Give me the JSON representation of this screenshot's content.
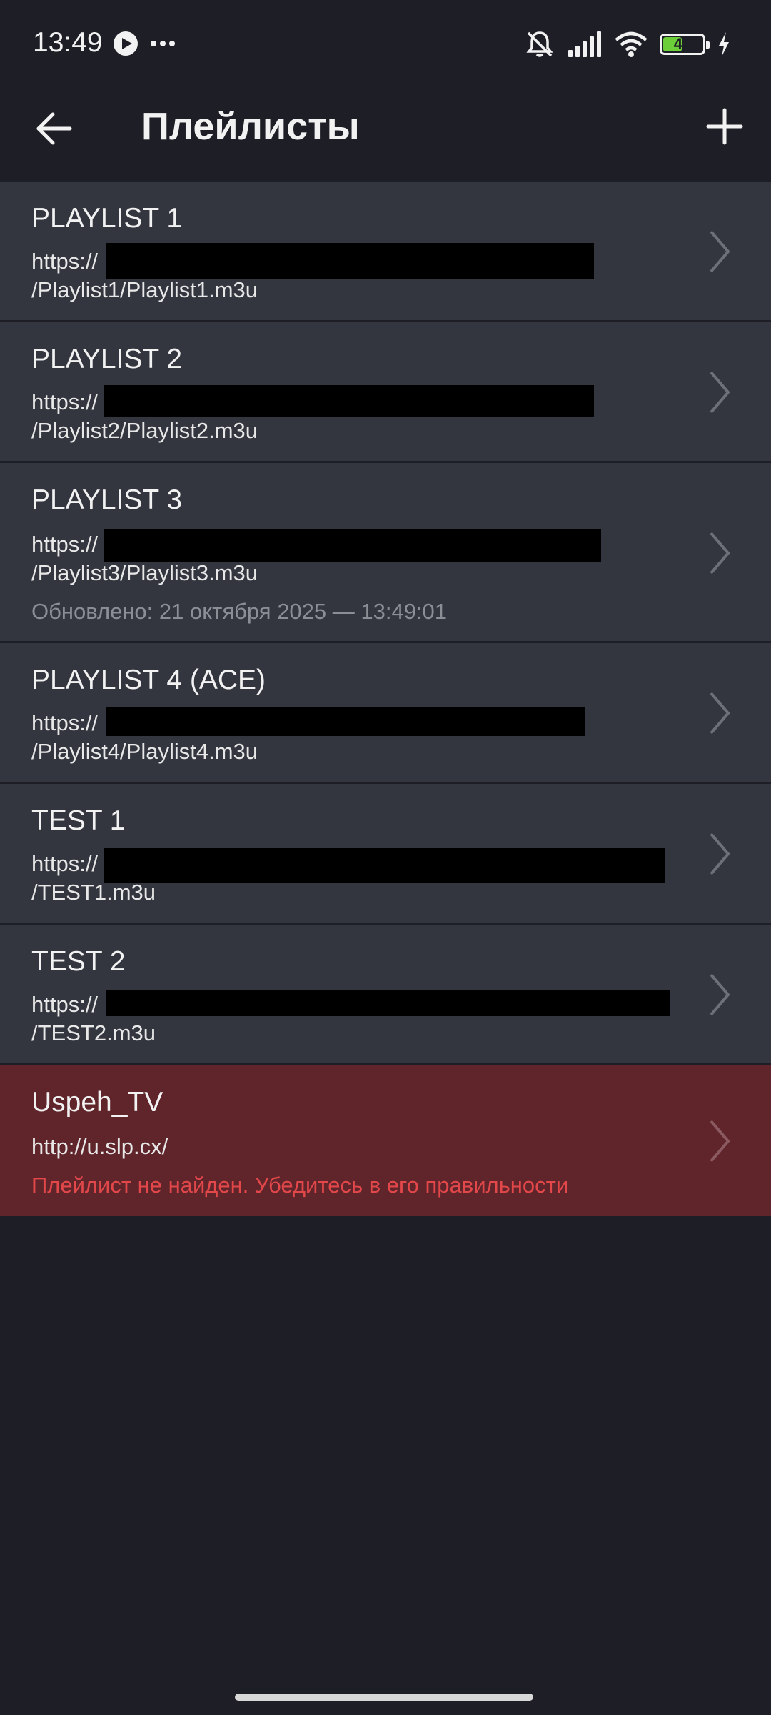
{
  "status_bar": {
    "time": "13:49",
    "battery_level": "47",
    "icons": [
      "play-badge-icon",
      "more-dots-icon",
      "mute-bell-icon",
      "signal-icon",
      "wifi-icon",
      "battery-icon",
      "charging-icon"
    ]
  },
  "app_bar": {
    "title": "Плейлисты",
    "back_icon": "arrow-left-icon",
    "add_icon": "plus-icon"
  },
  "playlists": [
    {
      "title": "PLAYLIST 1",
      "url_prefix": "https://",
      "url_path": "/Playlist1/Playlist1.m3u"
    },
    {
      "title": "PLAYLIST 2",
      "url_prefix": "https://",
      "url_path": "/Playlist2/Playlist2.m3u"
    },
    {
      "title": "PLAYLIST 3",
      "url_prefix": "https://",
      "url_path": "/Playlist3/Playlist3.m3u",
      "updated": "Обновлено: 21 октября 2025 — 13:49:01"
    },
    {
      "title": "PLAYLIST 4 (ACE)",
      "url_prefix": "https://",
      "url_path": "/Playlist4/Playlist4.m3u"
    },
    {
      "title": "TEST 1",
      "url_prefix": "https://",
      "url_path": "/TEST1.m3u"
    },
    {
      "title": "TEST 2",
      "url_prefix": "https://",
      "url_path": "/TEST2.m3u"
    },
    {
      "title": "Uspeh_TV",
      "url": "http://u.slp.cx/",
      "error": "Плейлист не найден. Убедитесь в его правильности"
    }
  ],
  "colors": {
    "background": "#1d1e26",
    "item_background": "#33353f",
    "error_item_background": "#5f252b",
    "error_text": "#e2474a",
    "secondary_text": "#8c8e96",
    "battery_fill": "#6ccf3a"
  }
}
